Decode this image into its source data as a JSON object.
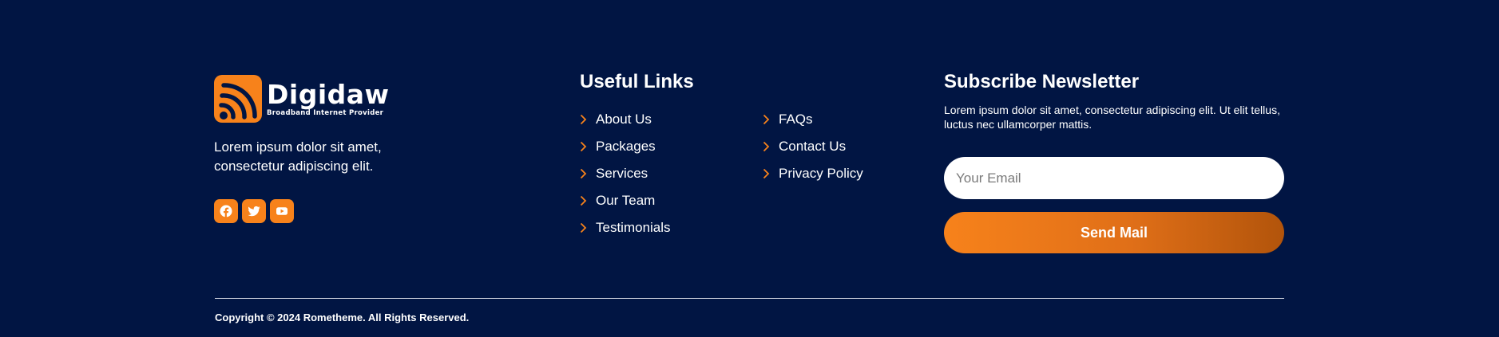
{
  "colors": {
    "background": "#011543",
    "accent": "#f7821b",
    "accent_dark": "#b2540b",
    "text": "#ffffff"
  },
  "brand": {
    "name": "Digidaw",
    "tagline": "Broadband Internet Provider",
    "logo_icon": "wifi-signal-icon",
    "description": "Lorem ipsum dolor sit amet, consectetur adipiscing elit.",
    "socials": [
      {
        "name": "Facebook",
        "icon": "facebook-icon"
      },
      {
        "name": "Twitter",
        "icon": "twitter-icon"
      },
      {
        "name": "YouTube",
        "icon": "youtube-icon"
      }
    ]
  },
  "useful_links": {
    "title": "Useful Links",
    "column_a": [
      "About Us",
      "Packages",
      "Services",
      "Our Team",
      "Testimonials"
    ],
    "column_b": [
      "FAQs",
      "Contact Us",
      "Privacy Policy"
    ],
    "item_icon": "chevron-right-icon"
  },
  "newsletter": {
    "title": "Subscribe Newsletter",
    "description": "Lorem ipsum dolor sit amet, consectetur adipiscing elit. Ut elit tellus, luctus nec ullamcorper mattis.",
    "email_placeholder": "Your Email",
    "email_value": "",
    "button_label": "Send Mail"
  },
  "copyright": "Copyright © 2024 Rometheme. All Rights Reserved."
}
